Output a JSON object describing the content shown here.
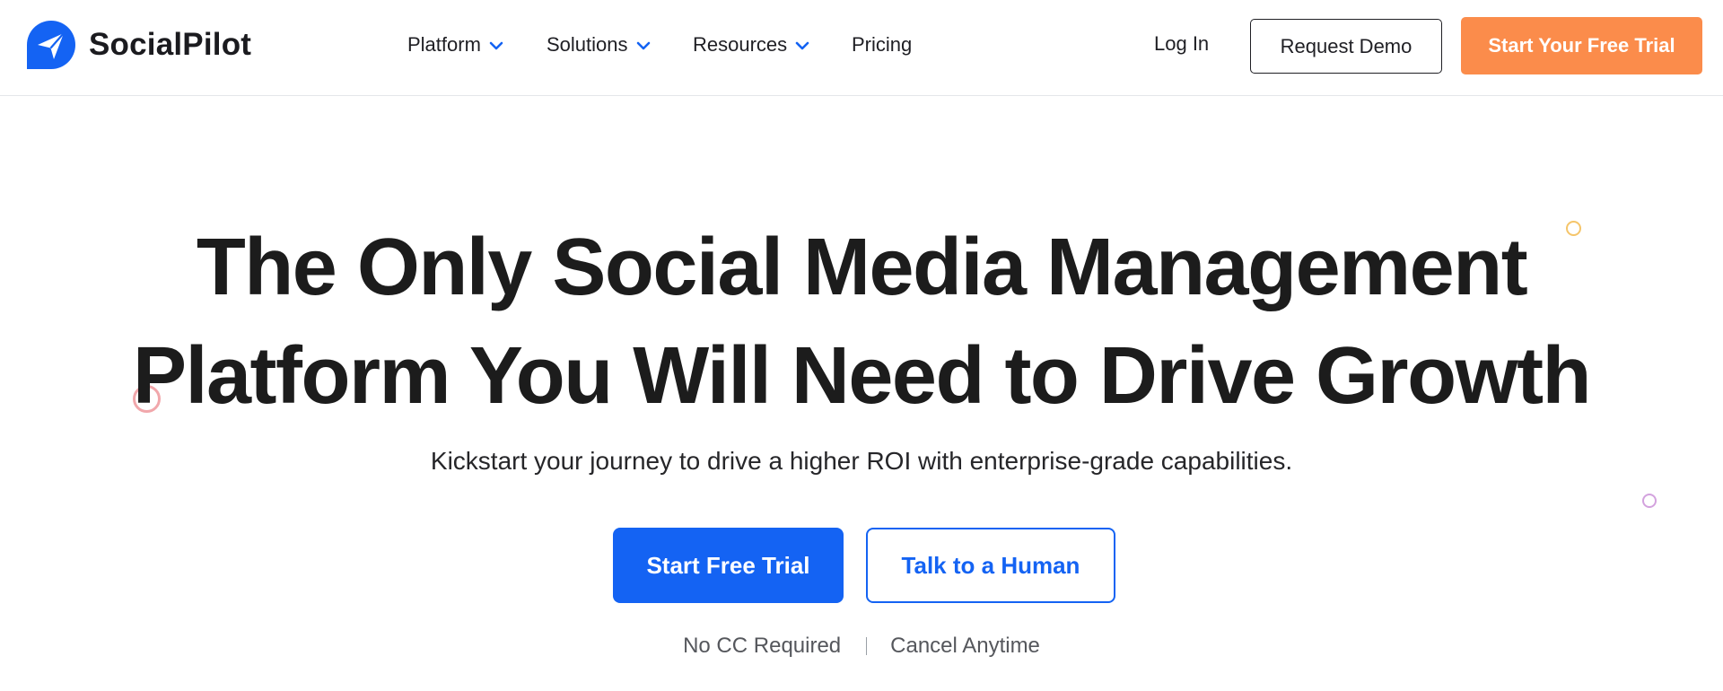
{
  "brand": {
    "name": "SocialPilot",
    "logo_icon": "paper-plane-icon",
    "brand_color": "#1463f3"
  },
  "nav": {
    "items": [
      {
        "label": "Platform",
        "has_dropdown": true
      },
      {
        "label": "Solutions",
        "has_dropdown": true
      },
      {
        "label": "Resources",
        "has_dropdown": true
      },
      {
        "label": "Pricing",
        "has_dropdown": false
      }
    ],
    "dropdown_icon": "chevron-down-icon",
    "chevron_color": "#1463f3"
  },
  "header_actions": {
    "login_label": "Log In",
    "demo_label": "Request Demo",
    "trial_label": "Start Your Free Trial",
    "trial_color": "#fb8c4b"
  },
  "hero": {
    "title_line1": "The Only Social Media Management",
    "title_line2": "Platform You Will Need to Drive Growth",
    "subtitle": "Kickstart your journey to drive a higher ROI with enterprise-grade capabilities.",
    "primary_cta": "Start Free Trial",
    "secondary_cta": "Talk to a Human",
    "note_1": "No CC Required",
    "note_2": "Cancel Anytime",
    "accent_color": "#1463f3"
  },
  "decorations": {
    "circle_colors": [
      "#f5c56a",
      "#f1a7ab",
      "#d3a2de"
    ]
  }
}
